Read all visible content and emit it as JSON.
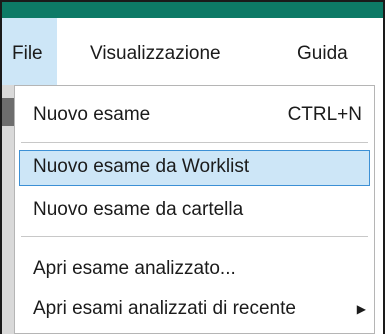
{
  "window": {
    "title_bar_color": "#0d7a66"
  },
  "menubar": {
    "items": [
      {
        "label": "File",
        "active": true
      },
      {
        "label": "Visualizzazione",
        "active": false
      },
      {
        "label": "Guida",
        "active": false
      }
    ]
  },
  "file_menu": {
    "items": [
      {
        "label": "Nuovo esame",
        "shortcut": "CTRL+N"
      },
      {
        "label": "Nuovo esame da Worklist",
        "highlighted": true
      },
      {
        "label": "Nuovo esame da cartella"
      },
      {
        "label": "Apri esame analizzato..."
      },
      {
        "label": "Apri esami analizzati di recente",
        "submenu_icon": "triangle-right-icon",
        "submenu_glyph": "▶"
      }
    ]
  },
  "colors": {
    "highlight_bg": "#cde6f7",
    "highlight_border": "#3c90d5"
  }
}
